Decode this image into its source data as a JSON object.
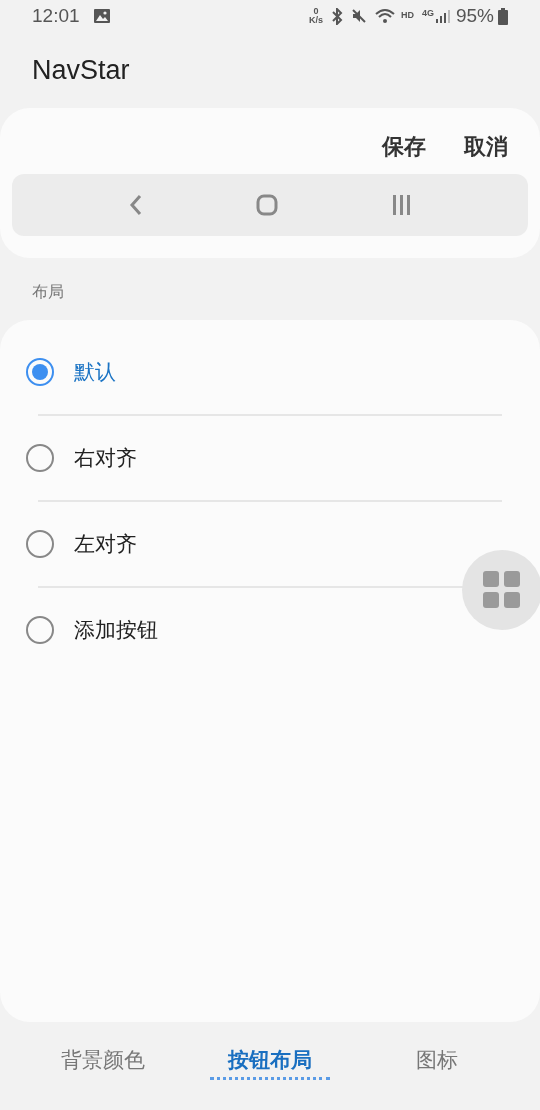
{
  "status_bar": {
    "time": "12:01",
    "speed_value": "0",
    "speed_unit": "K/s",
    "hd": "HD",
    "network": "4G",
    "battery": "95%"
  },
  "app_bar": {
    "title": "NavStar"
  },
  "preview": {
    "actions": [
      "保存",
      "取消"
    ]
  },
  "section": {
    "title": "布局"
  },
  "options": [
    {
      "label": "默认",
      "selected": true
    },
    {
      "label": "右对齐",
      "selected": false
    },
    {
      "label": "左对齐",
      "selected": false
    },
    {
      "label": "添加按钮",
      "selected": false
    }
  ],
  "tabs": [
    {
      "label": "背景颜色",
      "selected": false
    },
    {
      "label": "按钮布局",
      "selected": true
    },
    {
      "label": "图标",
      "selected": false
    }
  ]
}
